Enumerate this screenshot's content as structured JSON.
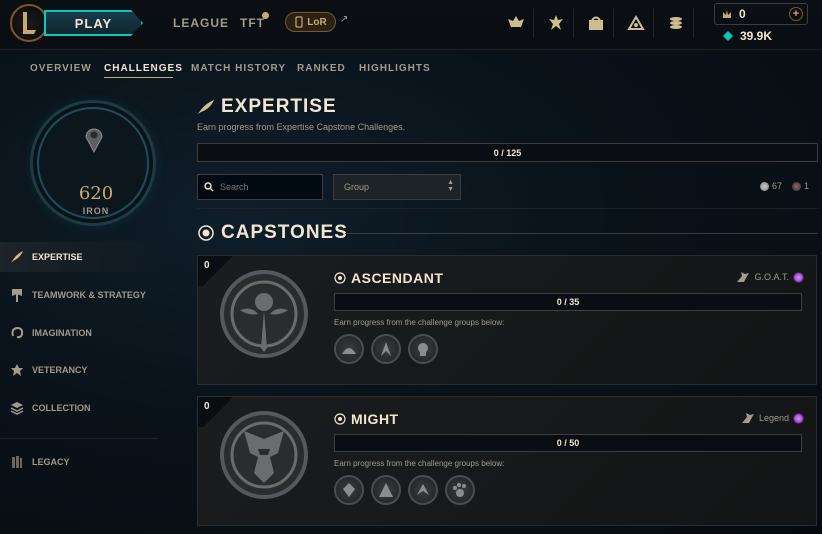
{
  "topbar": {
    "play_label": "PLAY",
    "nav": [
      {
        "label": "LEAGUE"
      },
      {
        "label": "TFT"
      }
    ],
    "lor_label": "LoR",
    "external_arrow": "↗",
    "icons": [
      "challenges-icon",
      "clash-icon",
      "store-bag-icon",
      "loot-icon",
      "collection-icon"
    ],
    "rp_amount": "0",
    "plus_label": "+",
    "be_amount": "39.9K"
  },
  "subnav": {
    "items": [
      "OVERVIEW",
      "CHALLENGES",
      "MATCH HISTORY",
      "RANKED",
      "HIGHLIGHTS"
    ],
    "active": "CHALLENGES"
  },
  "crest": {
    "score": "620",
    "rank": "IRON"
  },
  "sidebar": {
    "items": [
      {
        "label": "EXPERTISE",
        "icon": "quill-icon"
      },
      {
        "label": "TEAMWORK & STRATEGY",
        "icon": "banner-icon"
      },
      {
        "label": "IMAGINATION",
        "icon": "swirl-icon"
      },
      {
        "label": "VETERANCY",
        "icon": "laurel-icon"
      },
      {
        "label": "COLLECTION",
        "icon": "stack-icon"
      }
    ],
    "legacy_label": "LEGACY"
  },
  "main": {
    "title": "EXPERTISE",
    "subtitle": "Earn progress from Expertise Capstone Challenges.",
    "progress": "0 / 125",
    "progress_fraction": 0,
    "search_placeholder": "Search",
    "group_label": "Group",
    "count_silver": "67",
    "count_dark": "1",
    "capstones_title": "CAPSTONES"
  },
  "capstones": [
    {
      "count": "0",
      "name": "ASCENDANT",
      "reward": "G.O.A.T.",
      "progress": "0 / 35",
      "progress_fraction": 0,
      "hint": "Earn progress from the challenge groups below:",
      "group_icon_count": 3
    },
    {
      "count": "0",
      "name": "MIGHT",
      "reward": "Legend",
      "progress": "0 / 50",
      "progress_fraction": 0,
      "hint": "Earn progress from the challenge groups below:",
      "group_icon_count": 4
    }
  ],
  "colors": {
    "gold": "#c8aa6e",
    "teal": "#0ac8b9",
    "text": "#f0e6d2",
    "muted": "#a09b8c"
  }
}
